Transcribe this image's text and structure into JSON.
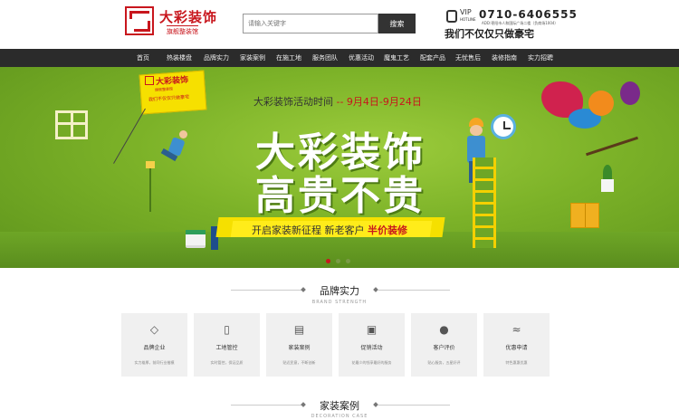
{
  "header": {
    "brand_name": "大彩装饰",
    "brand_sub": "旗舰整装馆",
    "search_placeholder": "请输入关键字",
    "search_button": "搜索",
    "vip_label": "VIP",
    "hotline_label": "HOTLINE",
    "phone": "0710-6406555",
    "address": "ADD:枣阳市人和国际广场二楼（负商场1004）",
    "slogan": "我们不仅仅只做豪宅"
  },
  "nav": {
    "items": [
      {
        "label": "首页"
      },
      {
        "label": "热装楼盘"
      },
      {
        "label": "品牌实力"
      },
      {
        "label": "家装案例"
      },
      {
        "label": "在施工地"
      },
      {
        "label": "服务团队"
      },
      {
        "label": "优惠活动"
      },
      {
        "label": "魔鬼工艺"
      },
      {
        "label": "配套产品"
      },
      {
        "label": "无忧售后"
      },
      {
        "label": "装修指南"
      },
      {
        "label": "实力招聘"
      }
    ]
  },
  "banner": {
    "flag_title": "大彩装饰",
    "flag_sub": "旗舰整装馆",
    "flag_slogan": "我们不仅仅只做豪宅",
    "headline_prefix": "大彩装饰活动时间",
    "headline_dates": "-- 9月4日-9月24日",
    "big_line1": "大彩装饰",
    "big_line2": "高贵不贵",
    "tagline_main": "开启家装新征程  新老客户",
    "tagline_highlight": "半价装修"
  },
  "slider": {
    "count": 3,
    "active_index": 0
  },
  "sections": {
    "brand": {
      "title": "品牌实力",
      "subtitle": "BRAND STRENGTH"
    },
    "cases": {
      "title": "家装案例",
      "subtitle": "DECORATION CASE"
    }
  },
  "cards": [
    {
      "icon": "diamond-icon",
      "glyph": "◇",
      "name": "品牌企业",
      "desc": "实力雄厚，前同行业楷模"
    },
    {
      "icon": "phone-icon",
      "glyph": "▯",
      "name": "工地管控",
      "desc": "实时管控，保证品质"
    },
    {
      "icon": "book-icon",
      "glyph": "▤",
      "name": "家装案例",
      "desc": "贴近民意，不断创新"
    },
    {
      "icon": "gift-icon",
      "glyph": "▣",
      "name": "促销活动",
      "desc": "花最少的钱享最好的服务"
    },
    {
      "icon": "thumbs-up-icon",
      "glyph": "●",
      "name": "客户评价",
      "desc": "贴心服务，五星好评"
    },
    {
      "icon": "handshake-icon",
      "glyph": "≈",
      "name": "优惠申请",
      "desc": "特色惠惠优惠"
    }
  ],
  "colors": {
    "brand_red": "#c8161d",
    "nav_bg": "#2b2b2b",
    "banner_green": "#7cb228",
    "highlight_yellow": "#f5e000"
  }
}
